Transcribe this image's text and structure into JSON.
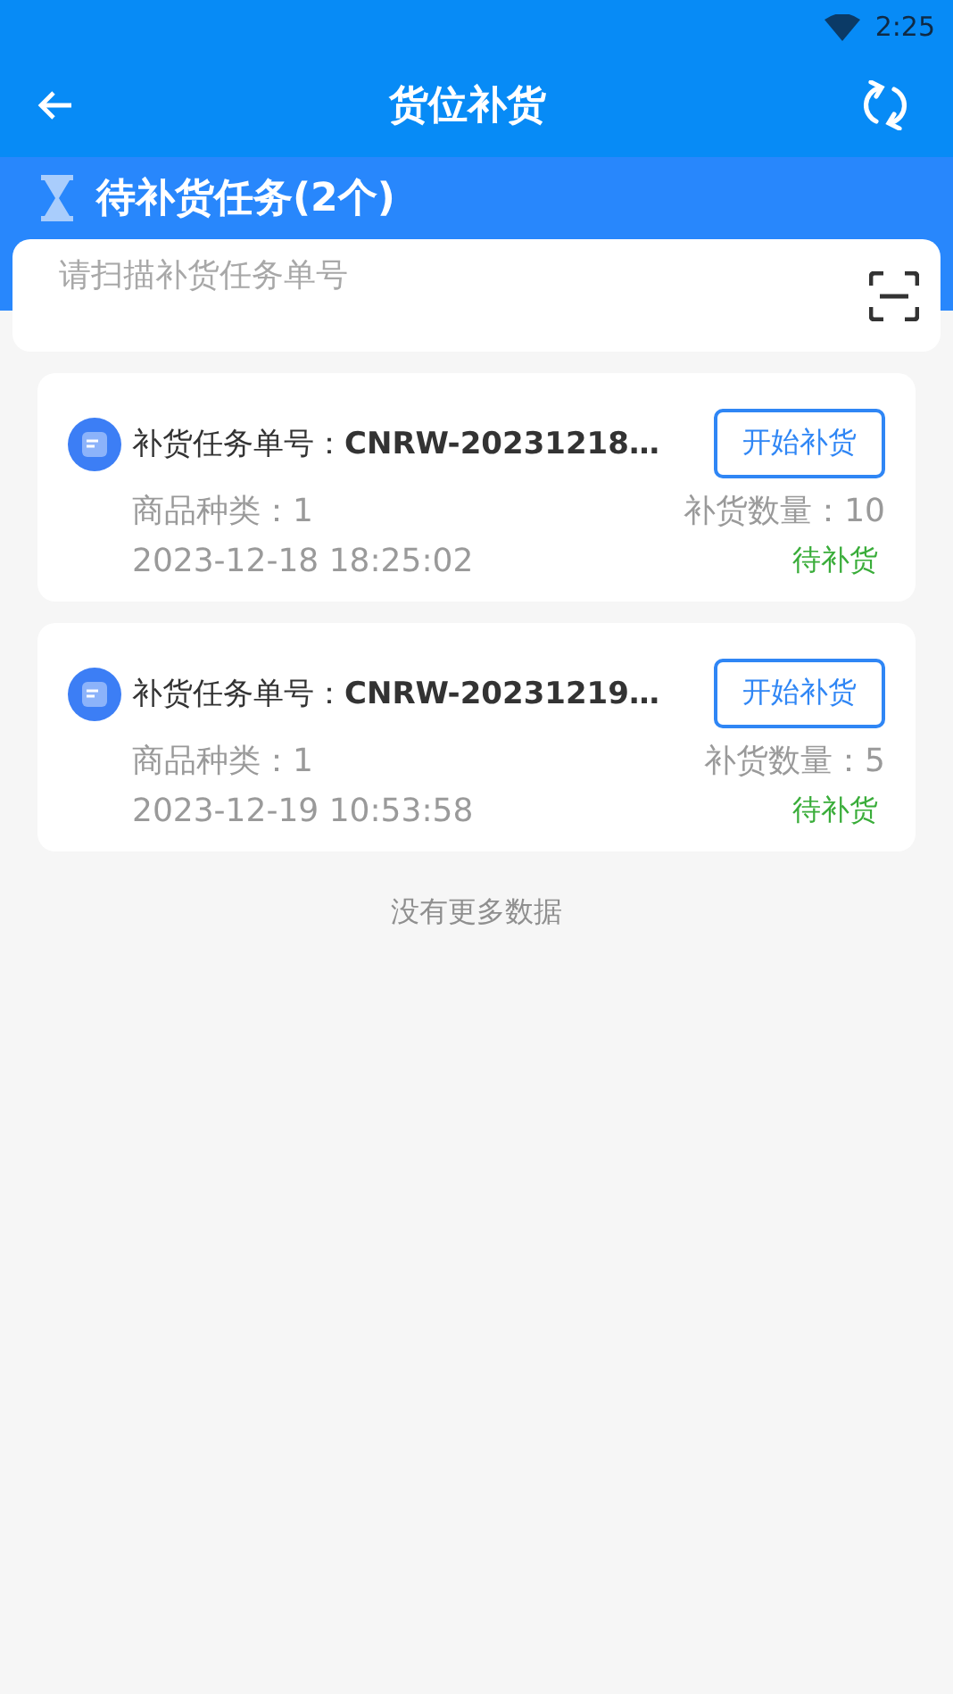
{
  "status_bar": {
    "time": "2:25"
  },
  "header": {
    "title": "货位补货"
  },
  "section": {
    "title": "待补货任务(2个)"
  },
  "search": {
    "placeholder": "请扫描补货任务单号"
  },
  "tasks": [
    {
      "order": "补货任务单号：**CNRW-20231218…**",
      "button": "开始补货",
      "category": "商品种类：1",
      "quantity": "补货数量：10",
      "time": "2023-12-18 18:25:02",
      "status": "待补货"
    },
    {
      "order": "补货任务单号：**CNRW-20231219…**",
      "button": "开始补货",
      "category": "商品种类：1",
      "quantity": "补货数量：5",
      "time": "2023-12-19 10:53:58",
      "status": "待补货"
    }
  ],
  "footer": "没有更多数据"
}
